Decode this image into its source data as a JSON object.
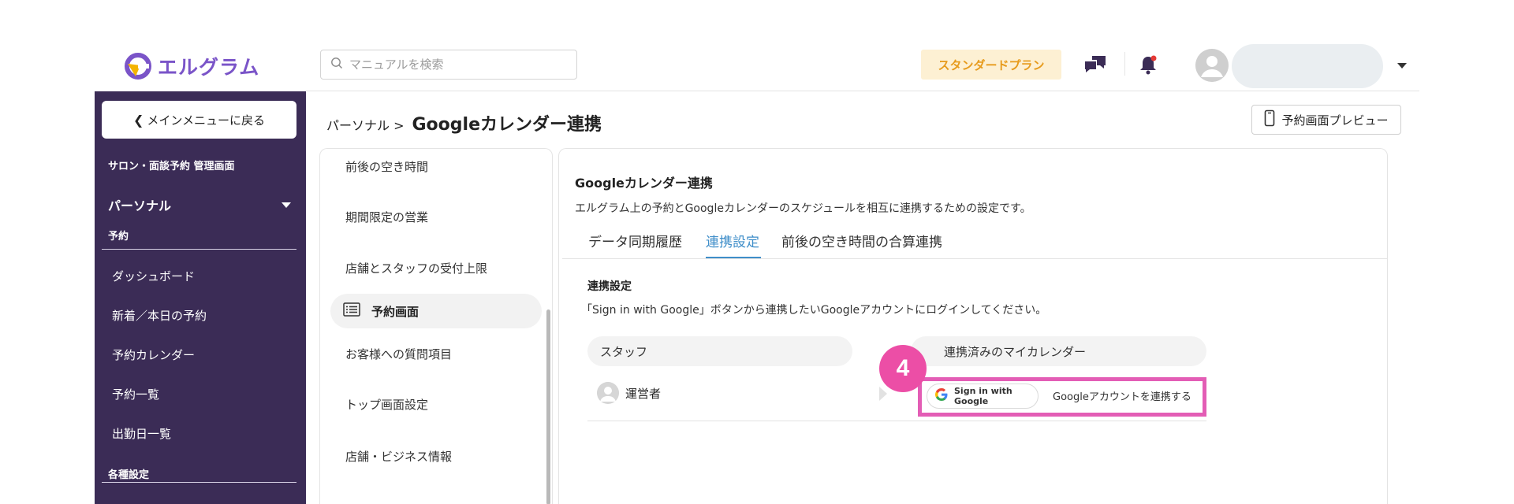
{
  "header": {
    "logo_text": "エルグラム",
    "search_placeholder": "マニュアルを検索",
    "plan_badge": "スタンダードプラン",
    "accent_color": "#7a54c8",
    "plan_color": "#e79b1c"
  },
  "sidebar": {
    "back_label": "メインメニューに戻る",
    "section_title": "サロン・面談予約 管理画面",
    "group_label": "パーソナル",
    "subgroup_label": "予約",
    "items": [
      "ダッシュボード",
      "新着／本日の予約",
      "予約カレンダー",
      "予約一覧",
      "出勤日一覧"
    ],
    "settings_label": "各種設定",
    "bg_color": "#3b2c56"
  },
  "page": {
    "breadcrumb_parent": "パーソナル >",
    "title": "Googleカレンダー連携",
    "preview_button": "予約画面プレビュー"
  },
  "settings_menu": {
    "items": [
      "前後の空き時間",
      "期間限定の営業",
      "店舗とスタッフの受付上限",
      "予約画面",
      "お客様への質問項目",
      "トップ画面設定",
      "店舗・ビジネス情報"
    ],
    "active_item": "予約画面"
  },
  "content": {
    "title": "Googleカレンダー連携",
    "description": "エルグラム上の予約とGoogleカレンダーのスケジュールを相互に連携するための設定です。",
    "tabs": [
      {
        "label": "データ同期履歴",
        "active": false
      },
      {
        "label": "連携設定",
        "active": true
      },
      {
        "label": "前後の空き時間の合算連携",
        "active": false
      }
    ],
    "tab_active_color": "#3f8ec9",
    "section_title": "連携設定",
    "section_description": "「Sign in with Google」ボタンから連携したいGoogleアカウントにログインしてください。",
    "columns": {
      "staff": "スタッフ",
      "calendar": "連携済みのマイカレンダー"
    },
    "row": {
      "staff_name": "運営者",
      "google_button": "Sign in with Google",
      "connect_label": "Googleアカウントを連携する"
    }
  },
  "annotation": {
    "step_number": "4",
    "color": "#e35db5"
  }
}
